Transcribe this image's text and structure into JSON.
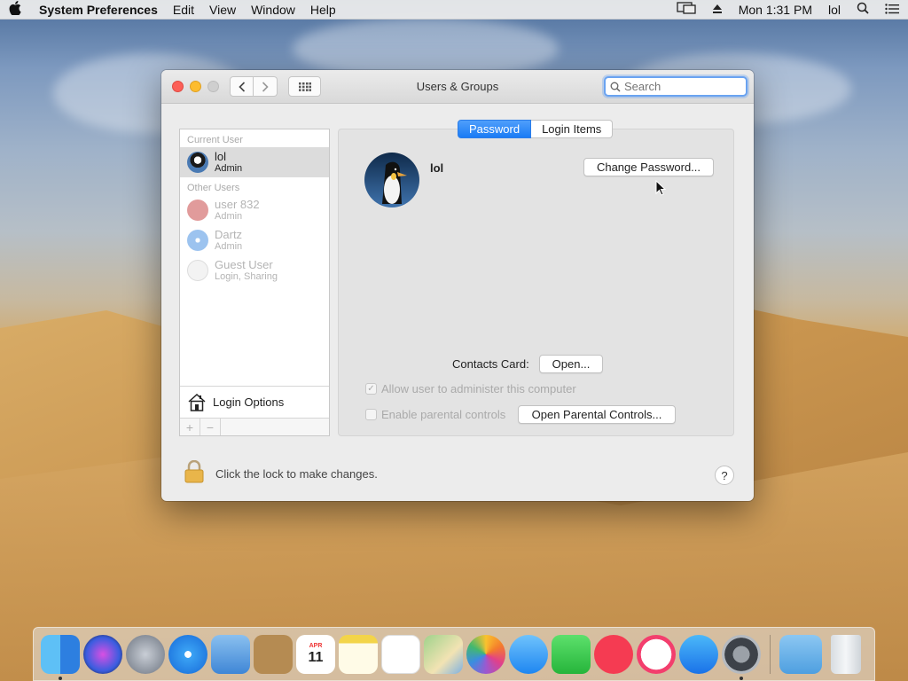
{
  "menubar": {
    "app_name": "System Preferences",
    "menus": [
      "Edit",
      "View",
      "Window",
      "Help"
    ],
    "clock": "Mon 1:31 PM",
    "user": "lol"
  },
  "window": {
    "title": "Users & Groups",
    "search_placeholder": "Search"
  },
  "sidebar": {
    "current_user_header": "Current User",
    "current_user": {
      "name": "lol",
      "role": "Admin"
    },
    "other_users_header": "Other Users",
    "other_users": [
      {
        "name": "user 832",
        "role": "Admin"
      },
      {
        "name": "Dartz",
        "role": "Admin"
      },
      {
        "name": "Guest User",
        "role": "Login, Sharing"
      }
    ],
    "login_options": "Login Options",
    "add_symbol": "+",
    "remove_symbol": "−"
  },
  "tabs": {
    "password": "Password",
    "login_items": "Login Items"
  },
  "detail": {
    "user_name": "lol",
    "change_password": "Change Password...",
    "contacts_label": "Contacts Card:",
    "open_button": "Open...",
    "allow_admin": "Allow user to administer this computer",
    "allow_admin_checked": true,
    "parental": "Enable parental controls",
    "parental_checked": false,
    "open_parental": "Open Parental Controls..."
  },
  "footer": {
    "lock_text": "Click the lock to make changes.",
    "help": "?"
  },
  "dock": {
    "items": [
      "finder-icon",
      "siri-icon",
      "launchpad-icon",
      "safari-icon",
      "mail-icon",
      "contacts-icon",
      "calendar-icon",
      "notes-icon",
      "reminders-icon",
      "maps-icon",
      "photos-icon",
      "messages-icon",
      "facetime-icon",
      "news-icon",
      "itunes-icon",
      "app-store-icon",
      "system-preferences-icon",
      "downloads-icon",
      "trash-icon"
    ],
    "calendar_month": "APR",
    "calendar_day": "11"
  }
}
